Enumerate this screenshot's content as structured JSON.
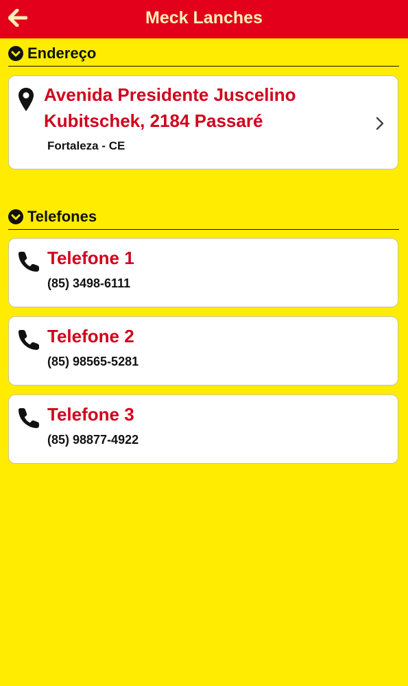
{
  "app": {
    "title": "Meck Lanches"
  },
  "address_section": {
    "title": "Endereço",
    "street_line1": "Avenida Presidente Juscelino",
    "street_line2": "Kubitschek, 2184 Passaré",
    "city": "Fortaleza - CE"
  },
  "phones_section": {
    "title": "Telefones",
    "items": [
      {
        "label": "Telefone 1",
        "number": "(85) 3498-6111"
      },
      {
        "label": "Telefone 2",
        "number": "(85) 98565-5281"
      },
      {
        "label": "Telefone 3",
        "number": "(85) 98877-4922"
      }
    ]
  },
  "colors": {
    "header_bg": "#e2001a",
    "page_bg": "#ffec00",
    "accent_text": "#d1001c",
    "title_text": "#ffefb8"
  },
  "icons": {
    "back": "arrow-left-icon",
    "section": "chevron-down-circle-icon",
    "address": "map-pin-icon",
    "phone": "phone-icon",
    "disclosure": "chevron-right-icon"
  }
}
